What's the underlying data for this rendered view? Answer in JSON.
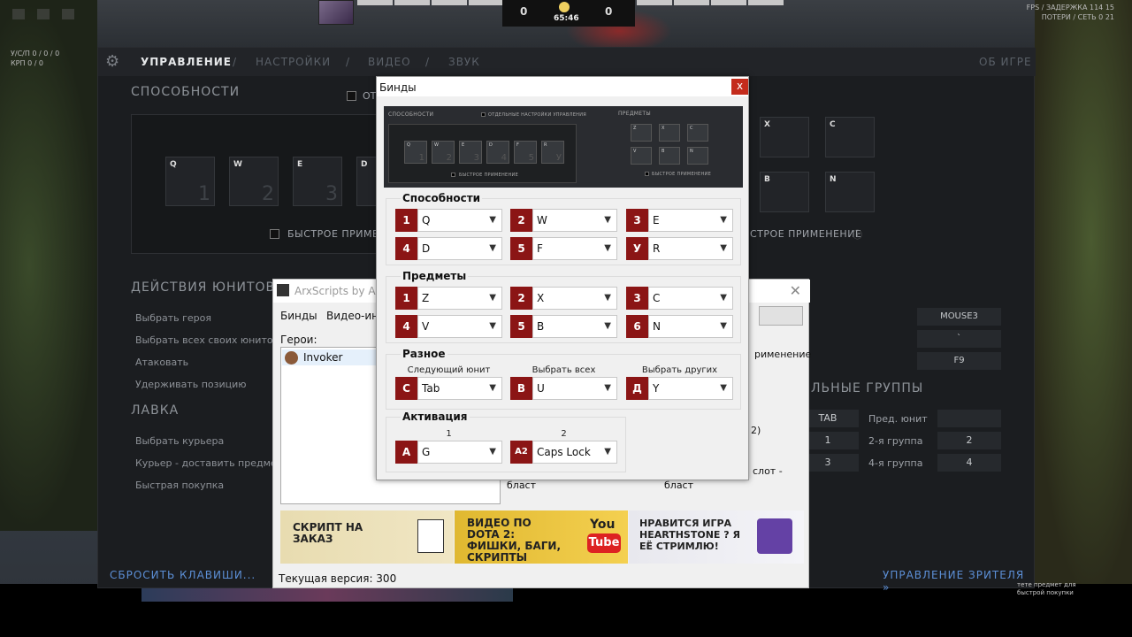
{
  "hud": {
    "score_left": "0",
    "score_right": "0",
    "time": "65:46"
  },
  "fps": {
    "line1": "FPS / ЗАДЕРЖКА 114 15",
    "line2": "ПОТЕРИ / СЕТЬ 0 21"
  },
  "kda": {
    "line1": "У/С/П 0 / 0 / 0",
    "line2": "КРП 0 / 0"
  },
  "dota": {
    "nav": [
      "УПРАВЛЕНИЕ",
      "/",
      "НАСТРОЙКИ",
      "/",
      "ВИДЕО",
      "/",
      "ЗВУК"
    ],
    "about": "ОБ ИГРЕ",
    "abilities_title": "СПОСОБНОСТИ",
    "checkbox_label": "ОТ",
    "ability_slots": [
      {
        "key": "Q",
        "num": "1"
      },
      {
        "key": "W",
        "num": "2"
      },
      {
        "key": "E",
        "num": "3"
      },
      {
        "key": "D",
        "num": ""
      }
    ],
    "item_slots": [
      "X",
      "C",
      "B",
      "N"
    ],
    "quickcast": "БЫСТРОЕ ПРИМЕНЕ",
    "quickcast_right": "СТРОЕ ПРИМЕНЕНИЕ",
    "unit_actions_title": "ДЕЙСТВИЯ ЮНИТОВ",
    "unit_actions": [
      "Выбрать героя",
      "Выбрать всех своих юнитов",
      "Атаковать",
      "Удерживать позицию"
    ],
    "shop_title": "ЛАВКА",
    "shop_actions": [
      "Выбрать курьера",
      "Курьер - доставить предмет",
      "Быстрая покупка"
    ],
    "right_values": [
      "MOUSE3",
      "`",
      "F9"
    ],
    "control_groups_title": "ЛЬНЫЕ ГРУППЫ",
    "groups_row1": [
      "TAB",
      "Пред. юнит"
    ],
    "groups_row2": [
      "1",
      "2-я группа",
      "2"
    ],
    "groups_row3": [
      "3",
      "4-я группа",
      "4"
    ],
    "reset_keys": "СБРОСИТЬ КЛАВИШИ...",
    "spectator": "УПРАВЛЕНИЕ ЗРИТЕЛЯ »",
    "hint": "тете предмет для быстрой покупки"
  },
  "arx": {
    "title": "ArxScripts by ArxP",
    "menu": [
      "Бинды",
      "Видео-инс"
    ],
    "heroes_label": "Герои:",
    "hero": "Invoker",
    "right_texts": [
      "рименение",
      "2)",
      "слот -",
      "бласт",
      "бласт"
    ],
    "banners": [
      {
        "text": "СКРИПТ НА ЗАКАЗ"
      },
      {
        "text": "ВИДЕО ПО DOTA 2: ФИШКИ, БАГИ, СКРИПТЫ"
      },
      {
        "text": "НРАВИТСЯ ИГРА HEARTHSTONE ? Я ЕЁ СТРИМЛЮ!"
      }
    ],
    "youtube_top": "You",
    "youtube_bottom": "Tube",
    "version": "Текущая версия: 300"
  },
  "binds": {
    "title": "Бинды",
    "close": "x",
    "preview": {
      "abilities": "СПОСОБНОСТИ",
      "separate": "ОТДЕЛЬНЫЕ НАСТРОЙКИ УПРАВЛЕНИЯ",
      "items": "ПРЕДМЕТЫ",
      "quickcast": "БЫСТРОЕ ПРИМЕНЕНИЕ",
      "slots": [
        {
          "k": "Q",
          "n": "1"
        },
        {
          "k": "W",
          "n": "2"
        },
        {
          "k": "E",
          "n": "3"
        },
        {
          "k": "D",
          "n": "4"
        },
        {
          "k": "F",
          "n": "5"
        },
        {
          "k": "R",
          "n": "У"
        }
      ],
      "items_slots": [
        "Z",
        "X",
        "C",
        "V",
        "B",
        "N"
      ]
    },
    "abilities_title": "Способности",
    "abilities": [
      {
        "badge": "1",
        "key": "Q"
      },
      {
        "badge": "2",
        "key": "W"
      },
      {
        "badge": "3",
        "key": "E"
      },
      {
        "badge": "4",
        "key": "D"
      },
      {
        "badge": "5",
        "key": "F"
      },
      {
        "badge": "У",
        "key": "R"
      }
    ],
    "items_title": "Предметы",
    "items": [
      {
        "badge": "1",
        "key": "Z"
      },
      {
        "badge": "2",
        "key": "X"
      },
      {
        "badge": "3",
        "key": "C"
      },
      {
        "badge": "4",
        "key": "V"
      },
      {
        "badge": "5",
        "key": "B"
      },
      {
        "badge": "6",
        "key": "N"
      }
    ],
    "misc_title": "Разное",
    "misc": [
      {
        "caption": "Следующий юнит",
        "badge": "С",
        "key": "Tab"
      },
      {
        "caption": "Выбрать всех",
        "badge": "В",
        "key": "U"
      },
      {
        "caption": "Выбрать других",
        "badge": "Д",
        "key": "Y"
      }
    ],
    "activation_title": "Активация",
    "activation": [
      {
        "caption": "1",
        "badge": "A",
        "key": "G"
      },
      {
        "caption": "2",
        "badge": "A2",
        "key": "Caps Lock"
      }
    ]
  }
}
